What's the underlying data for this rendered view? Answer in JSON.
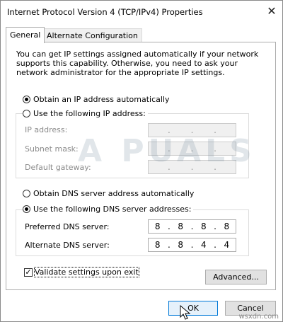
{
  "window": {
    "title": "Internet Protocol Version 4 (TCP/IPv4) Properties",
    "close_glyph": "✕"
  },
  "tabs": [
    {
      "label": "General",
      "active": true
    },
    {
      "label": "Alternate Configuration",
      "active": false
    }
  ],
  "description": "You can get IP settings assigned automatically if your network supports this capability. Otherwise, you need to ask your network administrator for the appropriate IP settings.",
  "ip": {
    "auto_label": "Obtain an IP address automatically",
    "manual_label": "Use the following IP address:",
    "fields": [
      {
        "label": "IP address:",
        "value": [
          ".",
          ".",
          "."
        ]
      },
      {
        "label": "Subnet mask:",
        "value": [
          ".",
          ".",
          "."
        ]
      },
      {
        "label": "Default gateway:",
        "value": [
          ".",
          ".",
          "."
        ]
      }
    ]
  },
  "dns": {
    "auto_label": "Obtain DNS server address automatically",
    "manual_label": "Use the following DNS server addresses:",
    "preferred_label": "Preferred DNS server:",
    "preferred_value": [
      "8",
      "8",
      "8",
      "8"
    ],
    "alternate_label": "Alternate DNS server:",
    "alternate_value": [
      "8",
      "8",
      "4",
      "4"
    ]
  },
  "validate": {
    "label": "Validate settings upon exit",
    "checked": true,
    "check_glyph": "✓"
  },
  "buttons": {
    "advanced": "Advanced...",
    "ok": "OK",
    "cancel": "Cancel"
  },
  "overlay": {
    "watermark": "A PUALS",
    "site": "wsxdn.com"
  }
}
